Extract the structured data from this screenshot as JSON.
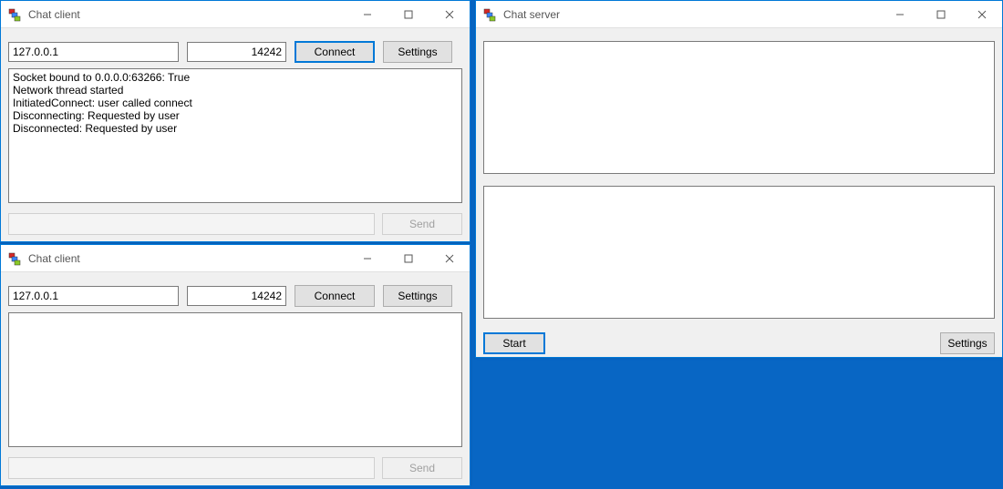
{
  "client1": {
    "title": "Chat client",
    "host": "127.0.0.1",
    "port": "14242",
    "connect_label": "Connect",
    "settings_label": "Settings",
    "log_text": "Socket bound to 0.0.0.0:63266: True\nNetwork thread started\nInitiatedConnect: user called connect\nDisconnecting: Requested by user\nDisconnected: Requested by user",
    "send_label": "Send"
  },
  "client2": {
    "title": "Chat client",
    "host": "127.0.0.1",
    "port": "14242",
    "connect_label": "Connect",
    "settings_label": "Settings",
    "log_text": "",
    "send_label": "Send"
  },
  "server": {
    "title": "Chat server",
    "start_label": "Start",
    "settings_label": "Settings"
  }
}
